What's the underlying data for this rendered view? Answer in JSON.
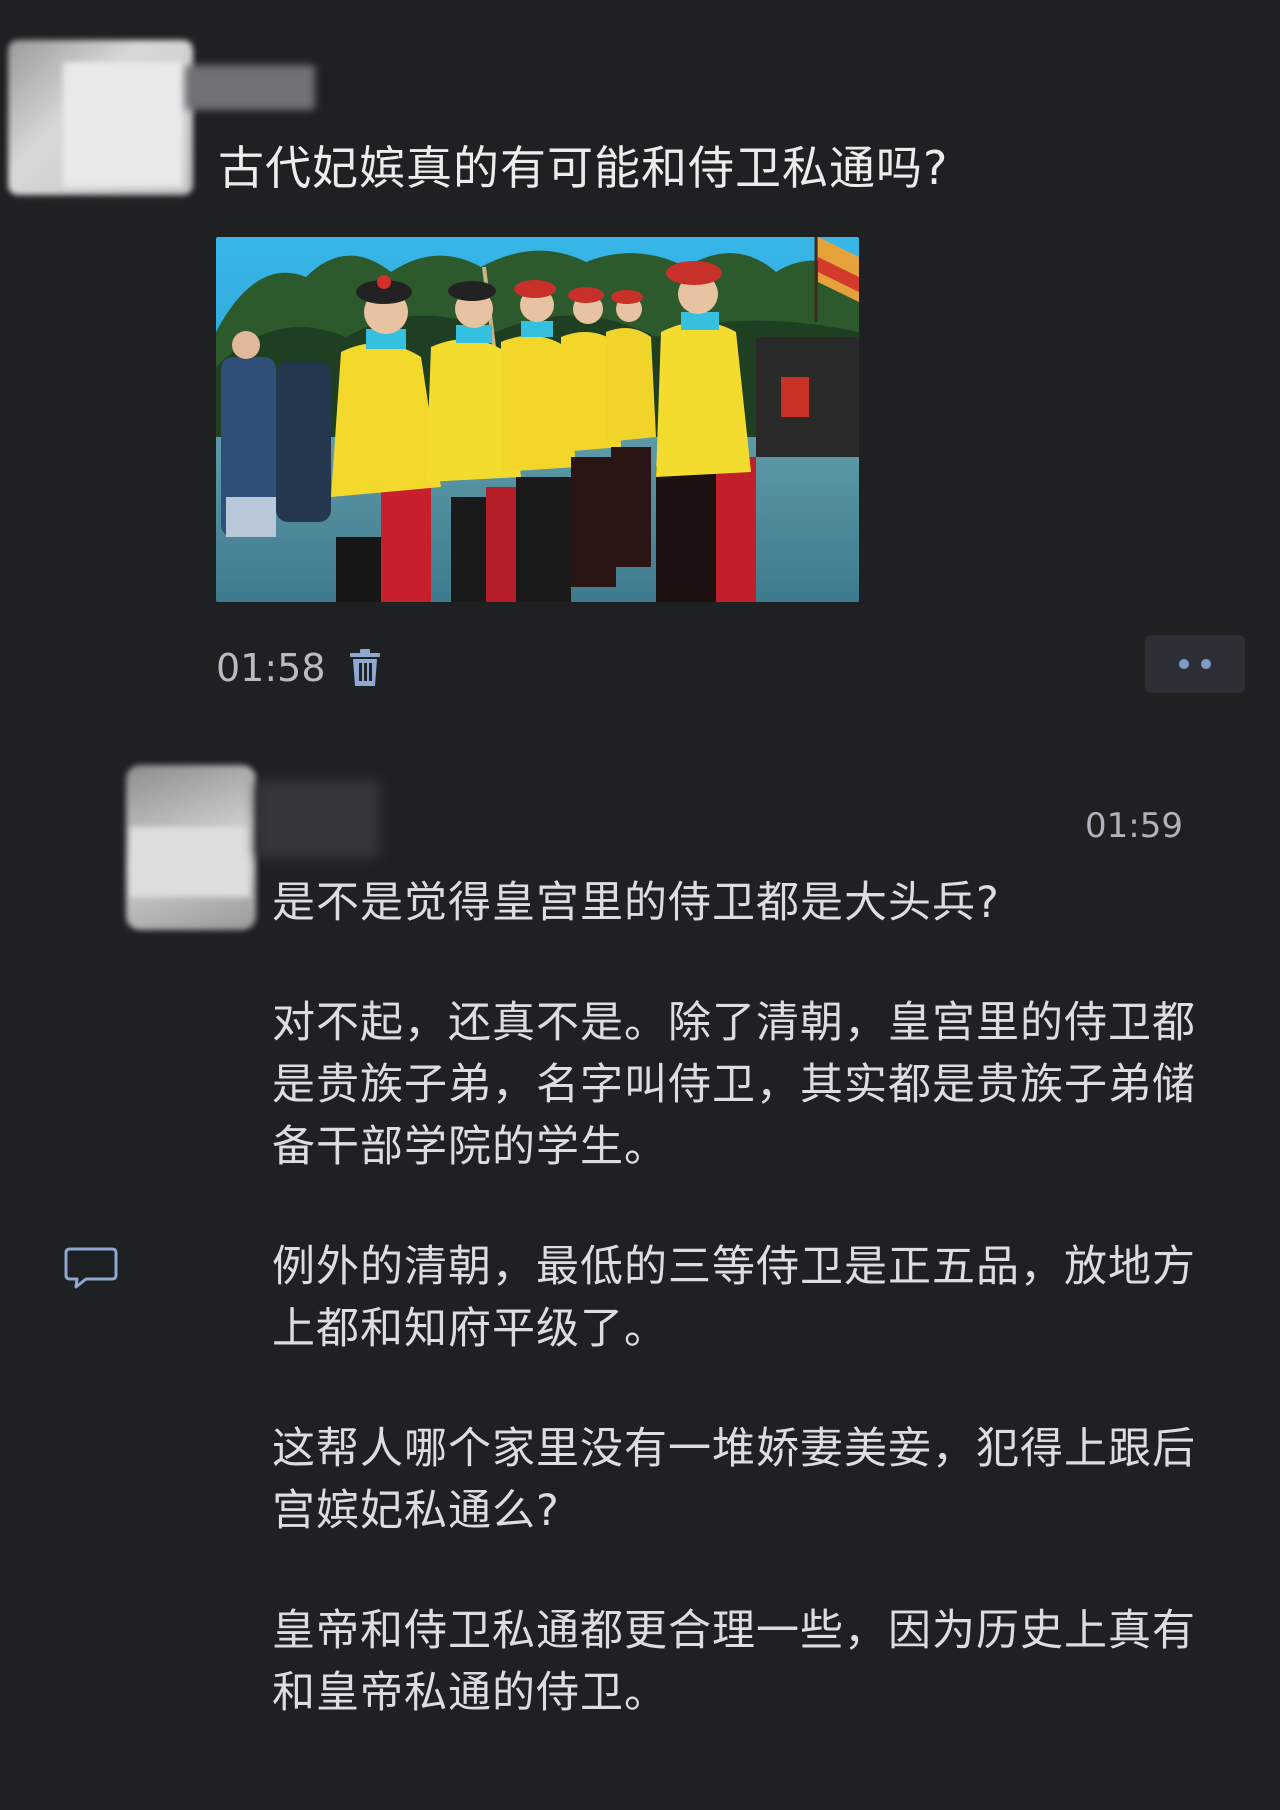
{
  "post": {
    "title": "古代妃嫔真的有可能和侍卫私通吗?",
    "time": "01:58",
    "image_icon": "photo-of-guards-in-yellow-robes",
    "delete_icon": "trash-icon",
    "more_icon": "more-dots-icon"
  },
  "comment": {
    "time": "01:59",
    "paragraphs": [
      "是不是觉得皇宫里的侍卫都是大头兵?",
      "对不起，还真不是。除了清朝，皇宫里的侍卫都是贵族子弟，名字叫侍卫，其实都是贵族子弟储备干部学院的学生。",
      "例外的清朝，最低的三等侍卫是正五品，放地方上都和知府平级了。",
      "这帮人哪个家里没有一堆娇妻美妾，犯得上跟后宫嫔妃私通么?",
      "皇帝和侍卫私通都更合理一些，因为历史上真有和皇帝私通的侍卫。"
    ],
    "reply_icon": "comment-bubble-icon"
  },
  "colors": {
    "background": "#1e2022",
    "text": "#e6e6e6",
    "accent": "#7f9bc7"
  }
}
